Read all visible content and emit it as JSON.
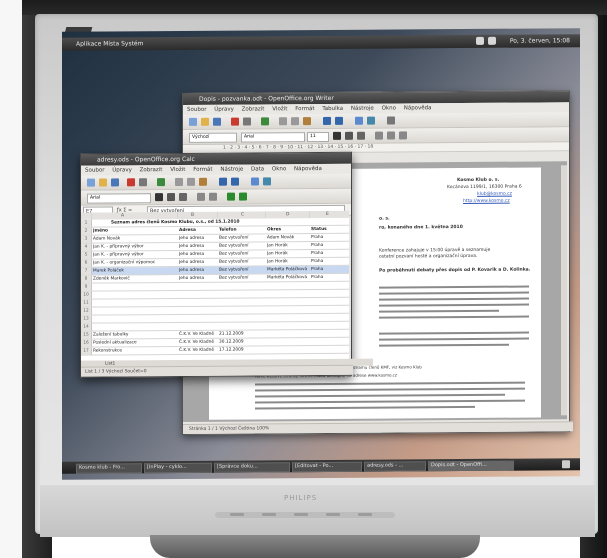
{
  "brand": "PHILIPS",
  "topbar": {
    "menus": "Aplikace  Místa  Systém",
    "clock": "Po, 3. červen, 15:08"
  },
  "writer": {
    "title": "Dopis - pozvanka.odt - OpenOffice.org Writer",
    "menu": [
      "Soubor",
      "Úpravy",
      "Zobrazit",
      "Vložit",
      "Formát",
      "Tabulka",
      "Nástroje",
      "Okno",
      "Nápověda"
    ],
    "style": "Výchozí",
    "font": "Arial",
    "size": "11",
    "ruler": "1 · 2 · 3 · 4 · 5 · 6 · 7 · 8 · 9 · 10 · 11 · 12 · 13 · 14 · 15 · 16 · 17 · 18",
    "company": "Kosmo Klub o. s.",
    "address": "Kocánova 1199/1, 16300 Praha 6",
    "email": "klub@kosmo.cz",
    "web": "http://www.kosmo.cz",
    "doc_heading": "o. s.",
    "doc_line2": "ro, konaného dne 1. května 2010",
    "doc_text1": "Konference zahajuje v 15:00 úpravě a seznamuje",
    "doc_text2": "ostatní pozvaní hosté a organizační úprava.",
    "doc_para": "Po proběhnutí debaty přes dopis od P. Kovarik a D. Kolinka.",
    "doc_list1": "Priloženy návrh programu schůze a aktuálního seznamu členů KMF, viz Kosmo Klub",
    "doc_list2": "Nové webové stránky Kosmo Klubu dostupné na adrese www.kosmo.cz",
    "status": "Stránka 1 / 1   Výchozí   Čeština   100%"
  },
  "calc": {
    "title": "adresy.ods - OpenOffice.org Calc",
    "menu": [
      "Soubor",
      "Úpravy",
      "Zobrazit",
      "Vložit",
      "Formát",
      "Nástroje",
      "Data",
      "Okno",
      "Nápověda"
    ],
    "cellref": "E7",
    "formula": "Bez vytvoření",
    "cols": [
      "A",
      "B",
      "C",
      "D",
      "E"
    ],
    "header": "Seznam adres členů Kosmo Klubu, o.s., od 15.1.2010",
    "table_head": [
      "Jméno",
      "Adresa",
      "Telefon",
      "Okres",
      "Status"
    ],
    "rows": [
      [
        "Adam Novák",
        "Jeho adresa",
        "Bez vytvoření",
        "Adam Novák",
        "Praha"
      ],
      [
        "Jan K. - přípravný výbor",
        "Jeho adresa",
        "Bez vytvoření",
        "Jan Horák",
        "Praha"
      ],
      [
        "Jan K. - přípravný výbor",
        "Jeho adresa",
        "Bez vytvoření",
        "Jan Horák",
        "Praha"
      ],
      [
        "Jan K. - organizační výpomoc",
        "Jeho adresa",
        "Bez vytvoření",
        "Jan Horák",
        "Praha"
      ],
      [
        "Marek Poláček",
        "Jeho adresa",
        "Bez vytvoření",
        "Markéta Poláčková",
        "Praha"
      ],
      [
        "Zdeněk Markovič",
        "Jeho adresa",
        "Bez vytvoření",
        "Markéta Poláčková",
        "Praha"
      ]
    ],
    "footer_rows": [
      [
        "Založení tabulky",
        "Č.K.V. Ve Kladně",
        "21.12.2009"
      ],
      [
        "Poslední aktualizace",
        "Č.K.V. Ve Kladně",
        "30.12.2009"
      ],
      [
        "Rekonstrukce",
        "Č.K.V. Ve Kladně",
        "17.12.2009"
      ]
    ],
    "sheettab": "List1",
    "status": "List 1 / 3   Výchozí   Součet=0"
  },
  "taskbar": [
    "Kosmo klub - Fro...",
    "[InPlay - cyklo...",
    "[Správce doku...",
    "[Editovat - Po...",
    "adresy.ods - ...",
    "Dopis.odt - OpenOffi..."
  ]
}
